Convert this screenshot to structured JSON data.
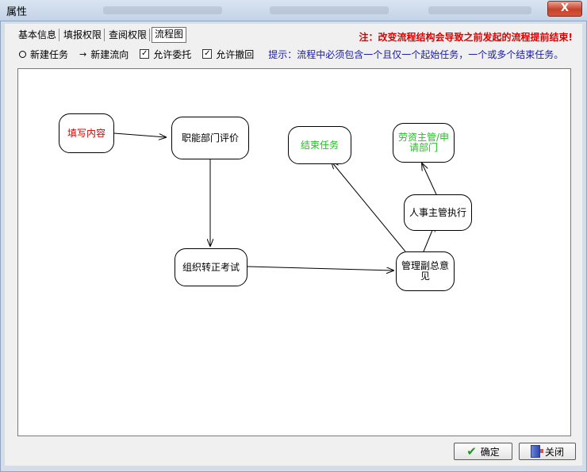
{
  "window": {
    "title": "属性",
    "close_label": "X"
  },
  "tabs": [
    {
      "label": "基本信息",
      "active": false
    },
    {
      "label": "填报权限",
      "active": false
    },
    {
      "label": "查阅权限",
      "active": false
    },
    {
      "label": "流程图",
      "active": true
    }
  ],
  "warning": "注：改变流程结构会导致之前发起的流程提前结束!",
  "toolbar": {
    "new_task": "新建任务",
    "new_flow": "新建流向",
    "allow_delegate": "允许委托",
    "allow_delegate_checked": true,
    "allow_withdraw": "允许撤回",
    "allow_withdraw_checked": true,
    "hint": "提示：流程中必须包含一个且仅一个起始任务，一个或多个结束任务。"
  },
  "flow": {
    "nodes": {
      "fill_content": {
        "label": "填写内容",
        "color": "#d00000"
      },
      "dept_review": {
        "label": "职能部门评价",
        "color": "#000000"
      },
      "exam": {
        "label": "组织转正考试",
        "color": "#000000"
      },
      "vp_opinion": {
        "label": "管理副总意见",
        "color": "#000000"
      },
      "hr_exec": {
        "label": "人事主管执行",
        "color": "#000000"
      },
      "end_task": {
        "label": "结束任务",
        "color": "#22c022"
      },
      "labor_dept": {
        "label": "劳资主管/申请部门",
        "color": "#22c022"
      }
    }
  },
  "buttons": {
    "ok": "确定",
    "close": "关闭"
  }
}
